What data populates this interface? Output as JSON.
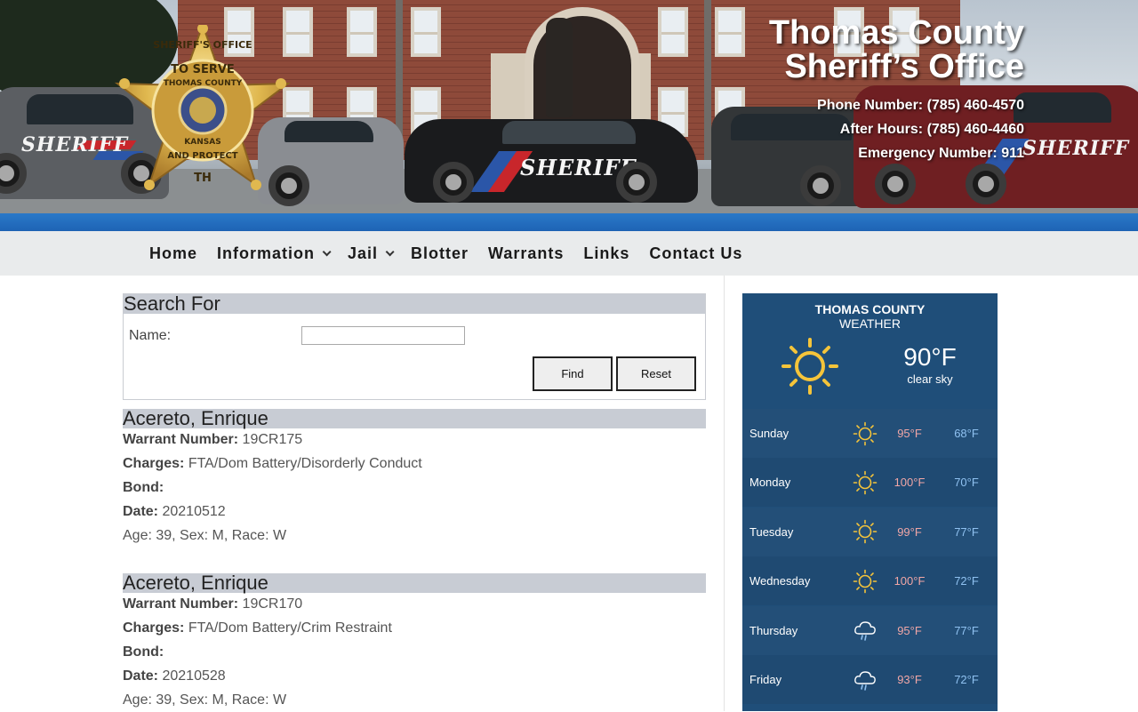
{
  "header": {
    "title_line1": "Thomas County",
    "title_line2": "Sheriff’s Office",
    "phone": "Phone Number: (785) 460-4570",
    "after_hours": "After Hours: (785) 460-4460",
    "emergency": "Emergency Number: 911",
    "badge": {
      "top": "SHERIFF'S OFFICE",
      "motto_top": "TO SERVE",
      "county": "THOMAS COUNTY",
      "state": "KANSAS",
      "motto_bottom": "AND PROTECT",
      "initials": "TH"
    },
    "vehicle_text": "SHERIFF",
    "vehicle_subtext": "THOMAS COUNTY"
  },
  "nav": {
    "items": [
      {
        "label": "Home",
        "dropdown": false
      },
      {
        "label": "Information",
        "dropdown": true
      },
      {
        "label": "Jail",
        "dropdown": true
      },
      {
        "label": "Blotter",
        "dropdown": false
      },
      {
        "label": "Warrants",
        "dropdown": false
      },
      {
        "label": "Links",
        "dropdown": false
      },
      {
        "label": "Contact Us",
        "dropdown": false
      }
    ]
  },
  "search": {
    "title": "Search For",
    "name_label": "Name:",
    "name_value": "",
    "find_label": "Find",
    "reset_label": "Reset"
  },
  "records": [
    {
      "name": "Acereto, Enrique",
      "warrant_label": "Warrant Number:",
      "warrant": "19CR175",
      "charges_label": "Charges:",
      "charges": "FTA/Dom Battery/Disorderly Conduct",
      "bond_label": "Bond:",
      "bond": "",
      "date_label": "Date:",
      "date": "20210512",
      "demographics": "Age: 39, Sex: M, Race: W"
    },
    {
      "name": "Acereto, Enrique",
      "warrant_label": "Warrant Number:",
      "warrant": "19CR170",
      "charges_label": "Charges:",
      "charges": "FTA/Dom Battery/Crim Restraint",
      "bond_label": "Bond:",
      "bond": "",
      "date_label": "Date:",
      "date": "20210528",
      "demographics": "Age: 39, Sex: M, Race: W"
    }
  ],
  "weather": {
    "city": "THOMAS COUNTY",
    "subtitle": "WEATHER",
    "current_temp": "90°F",
    "current_desc": "clear sky",
    "current_icon": "sun-icon",
    "days": [
      {
        "day": "Sunday",
        "icon": "sun-icon",
        "high": "95°F",
        "low": "68°F"
      },
      {
        "day": "Monday",
        "icon": "sun-icon",
        "high": "100°F",
        "low": "70°F"
      },
      {
        "day": "Tuesday",
        "icon": "sun-icon",
        "high": "99°F",
        "low": "77°F"
      },
      {
        "day": "Wednesday",
        "icon": "sun-icon",
        "high": "100°F",
        "low": "72°F"
      },
      {
        "day": "Thursday",
        "icon": "rain-cloud-icon",
        "high": "95°F",
        "low": "77°F"
      },
      {
        "day": "Friday",
        "icon": "rain-cloud-icon",
        "high": "93°F",
        "low": "72°F"
      }
    ],
    "colors": {
      "panel": "#1f4e79",
      "high": "#f0a6a6",
      "low": "#8fc1f0",
      "sun": "#f5c43a"
    }
  }
}
